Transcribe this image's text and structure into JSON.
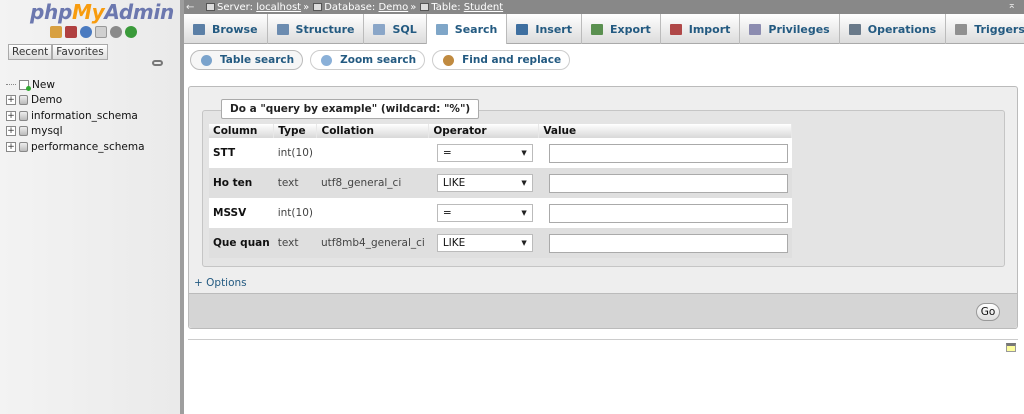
{
  "nav": {
    "logo_php": "php",
    "logo_my": "My",
    "logo_admin": "Admin",
    "recent_label": "Recent",
    "favorites_label": "Favorites",
    "tree": [
      {
        "label": "New",
        "kind": "new"
      },
      {
        "label": "Demo",
        "kind": "db"
      },
      {
        "label": "information_schema",
        "kind": "db"
      },
      {
        "label": "mysql",
        "kind": "db"
      },
      {
        "label": "performance_schema",
        "kind": "db"
      }
    ]
  },
  "breadcrumb": {
    "server_label": "Server:",
    "server": "localhost",
    "database_label": "Database:",
    "database": "Demo",
    "table_label": "Table:",
    "table": "Student",
    "sep": "»"
  },
  "tabs": [
    {
      "label": "Browse",
      "icon_color": "#5b7fa6"
    },
    {
      "label": "Structure",
      "icon_color": "#6c8cb0"
    },
    {
      "label": "SQL",
      "icon_color": "#8aa6c8"
    },
    {
      "label": "Search",
      "icon_color": "#7fa6c8",
      "active": true
    },
    {
      "label": "Insert",
      "icon_color": "#3e6fa0"
    },
    {
      "label": "Export",
      "icon_color": "#5a9050"
    },
    {
      "label": "Import",
      "icon_color": "#b04848"
    },
    {
      "label": "Privileges",
      "icon_color": "#8c8cb0"
    },
    {
      "label": "Operations",
      "icon_color": "#6a7a8a"
    },
    {
      "label": "Triggers",
      "icon_color": "#909090"
    }
  ],
  "subtabs": [
    {
      "label": "Table search",
      "icon_color": "#7aa3cc",
      "active": true
    },
    {
      "label": "Zoom search",
      "icon_color": "#8ab0d8"
    },
    {
      "label": "Find and replace",
      "icon_color": "#c08a40"
    }
  ],
  "form": {
    "legend": "Do a \"query by example\" (wildcard: \"%\")",
    "headers": {
      "column": "Column",
      "type": "Type",
      "collation": "Collation",
      "operator": "Operator",
      "value": "Value"
    },
    "rows": [
      {
        "column": "STT",
        "type": "int(10)",
        "collation": "",
        "operator": "=",
        "value": ""
      },
      {
        "column": "Ho ten",
        "type": "text",
        "collation": "utf8_general_ci",
        "operator": "LIKE",
        "value": ""
      },
      {
        "column": "MSSV",
        "type": "int(10)",
        "collation": "",
        "operator": "=",
        "value": ""
      },
      {
        "column": "Que quan",
        "type": "text",
        "collation": "utf8mb4_general_ci",
        "operator": "LIKE",
        "value": ""
      }
    ],
    "options_label": "+ Options",
    "go_label": "Go"
  }
}
